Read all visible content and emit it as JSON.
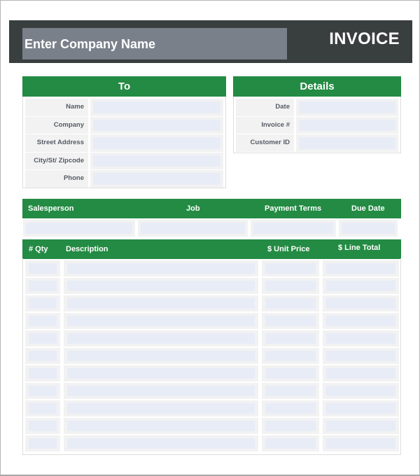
{
  "header": {
    "company_placeholder": "Enter Company Name",
    "title": "INVOICE"
  },
  "to_panel": {
    "title": "To",
    "fields": [
      {
        "label": "Name",
        "value": ""
      },
      {
        "label": "Company",
        "value": ""
      },
      {
        "label": "Street Address",
        "value": ""
      },
      {
        "label": "City/St/ Zipcode",
        "value": ""
      },
      {
        "label": "Phone",
        "value": ""
      }
    ]
  },
  "details_panel": {
    "title": "Details",
    "fields": [
      {
        "label": "Date",
        "value": ""
      },
      {
        "label": "Invoice #",
        "value": ""
      },
      {
        "label": "Customer ID",
        "value": ""
      }
    ]
  },
  "meta_table": {
    "columns": [
      "Salesperson",
      "Job",
      "Payment Terms",
      "Due Date"
    ],
    "values": [
      "",
      "",
      "",
      ""
    ]
  },
  "items_table": {
    "columns": [
      "# Qty",
      "Description",
      "$ Unit Price",
      "$ Line Total"
    ],
    "rows": [
      [
        "",
        "",
        "",
        ""
      ],
      [
        "",
        "",
        "",
        ""
      ],
      [
        "",
        "",
        "",
        ""
      ],
      [
        "",
        "",
        "",
        ""
      ],
      [
        "",
        "",
        "",
        ""
      ],
      [
        "",
        "",
        "",
        ""
      ],
      [
        "",
        "",
        "",
        ""
      ],
      [
        "",
        "",
        "",
        ""
      ],
      [
        "",
        "",
        "",
        ""
      ],
      [
        "",
        "",
        "",
        ""
      ],
      [
        "",
        "",
        "",
        ""
      ]
    ]
  },
  "colors": {
    "header_bg": "#393e3f",
    "company_field_bg": "#7a808a",
    "accent_green": "#238b43",
    "input_bg": "#e8ecf7",
    "cell_bg": "#f2f2f2"
  }
}
